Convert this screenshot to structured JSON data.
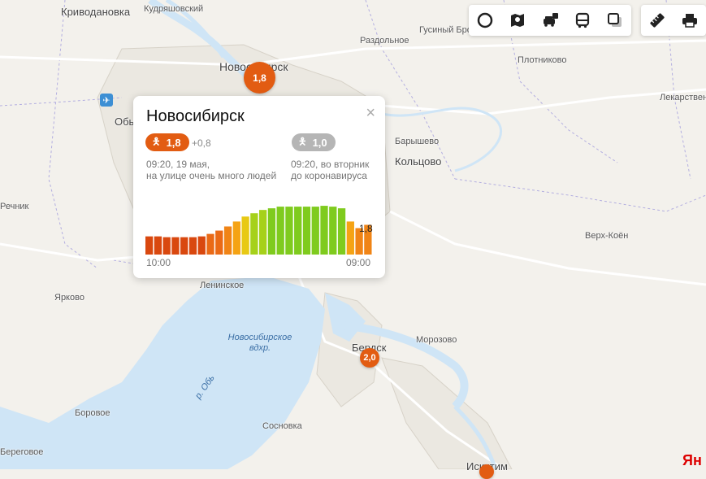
{
  "map": {
    "places": {
      "krivodanovka": "Криводановка",
      "kudryashovsky": "Кудряшовский",
      "razdolnoe": "Раздольное",
      "gusiny_brod": "Гусиный Брод",
      "novosibirsk": "Новосибирск",
      "plotnikovo": "Плотниково",
      "ob": "Обь",
      "lekarstvennoe": "Лекарственное",
      "baryshevo": "Барышево",
      "koltsovo": "Кольцово",
      "rechnik": "Речник",
      "verkh_koen": "Верх-Коён",
      "leninskoe": "Ленинское",
      "yarkovo": "Ярково",
      "morozovo": "Морозово",
      "berdsk": "Бердск",
      "reservoir": "Новосибирское вдхр.",
      "river_ob": "р. Обь",
      "borovoe": "Боровое",
      "sosnovka": "Сосновка",
      "beregovoe": "Береговое",
      "iskitim": "Искитим"
    },
    "markers": [
      {
        "id": "novosibirsk",
        "value": "1,8"
      },
      {
        "id": "berdsk",
        "value": "2,0"
      }
    ],
    "colors": {
      "water": "#cfe5f6",
      "land": "#f3f1ec",
      "urban": "#e9e6df",
      "marker": "#e25c12",
      "border": "#a9a3d6"
    }
  },
  "toolbar": {
    "icons": [
      "circle-icon",
      "layers-map-icon",
      "traffic-icon",
      "transit-icon",
      "layer-switch-icon",
      "ruler-icon",
      "print-icon"
    ]
  },
  "popup": {
    "title": "Новосибирск",
    "close_glyph": "×",
    "current": {
      "value": "1,8",
      "delta": "+0,8",
      "time": "09:20, 19 мая,",
      "desc": "на улице очень много людей",
      "color": "#e25c12"
    },
    "baseline": {
      "value": "1,0",
      "time": "09:20, во вторник",
      "desc": "до коронавируса",
      "color": "#b5b5b5"
    },
    "chart_data": {
      "type": "bar",
      "values": [
        1.1,
        1.1,
        1.05,
        1.05,
        1.05,
        1.05,
        1.1,
        1.25,
        1.45,
        1.7,
        2.0,
        2.3,
        2.5,
        2.7,
        2.8,
        2.9,
        2.9,
        2.9,
        2.9,
        2.9,
        2.95,
        2.9,
        2.8,
        2.0,
        1.6,
        1.8
      ],
      "x_start_label": "10:00",
      "x_end_label": "09:00",
      "last_value_label": "1,8",
      "ylim": [
        0,
        3.2
      ]
    }
  },
  "brand_text": "Ян"
}
